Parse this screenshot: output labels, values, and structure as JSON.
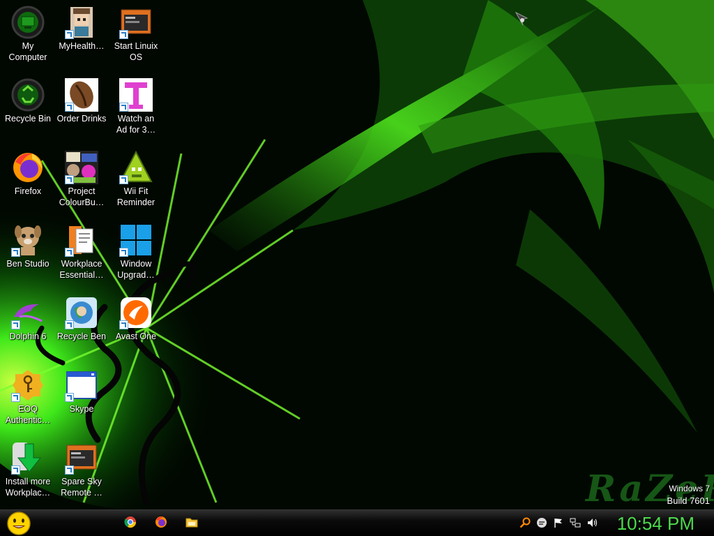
{
  "desktop": {
    "icons": [
      {
        "label": "My\nComputer",
        "icon": "my-computer-icon"
      },
      {
        "label": "MyHealth…",
        "icon": "pixel-person-icon"
      },
      {
        "label": "Start Linuix\nOS",
        "icon": "terminal-window-icon"
      },
      {
        "label": "Recycle Bin",
        "icon": "recycle-bin-icon"
      },
      {
        "label": "Order Drinks",
        "icon": "coffee-bean-icon"
      },
      {
        "label": "Watch an\nAd for 3…",
        "icon": "pink-t-icon"
      },
      {
        "label": "Firefox",
        "icon": "firefox-icon"
      },
      {
        "label": "Project\nColourBu…",
        "icon": "collage-icon"
      },
      {
        "label": "Wii Fit\nReminder",
        "icon": "pixel-triangle-icon"
      },
      {
        "label": "Ben Studio",
        "icon": "talking-dog-icon"
      },
      {
        "label": "Workplace\nEssential…",
        "icon": "documents-icon"
      },
      {
        "label": "Window\nUpgrad…",
        "icon": "windows-logo-icon"
      },
      {
        "label": "Dolphin 6",
        "icon": "dolphin-icon"
      },
      {
        "label": "Recycle Ben",
        "icon": "earth-recycle-icon"
      },
      {
        "label": "Avast One",
        "icon": "avast-icon"
      },
      {
        "label": "EOQ\nAuthentic…",
        "icon": "key-badge-icon"
      },
      {
        "label": "Skype",
        "icon": "app-window-icon"
      },
      {
        "label": "Install more\nWorkplac…",
        "icon": "download-arrow-icon"
      },
      {
        "label": "Spare Sky\nRemote …",
        "icon": "terminal-window-icon"
      }
    ],
    "watermark": {
      "line1": "Windows 7",
      "line2": "Build 7601"
    },
    "logo_text": "RaZeR"
  },
  "taskbar": {
    "start_icon": "smiley-start-icon",
    "pinned": [
      "chrome-icon",
      "firefox-icon",
      "folder-icon"
    ],
    "tray": [
      "search-icon",
      "chat-icon",
      "flag-icon",
      "network-icon",
      "volume-icon"
    ],
    "clock": "10:54 PM"
  },
  "colors": {
    "accent": "#4cd94c",
    "wallpaper_green": "#39e01a"
  }
}
